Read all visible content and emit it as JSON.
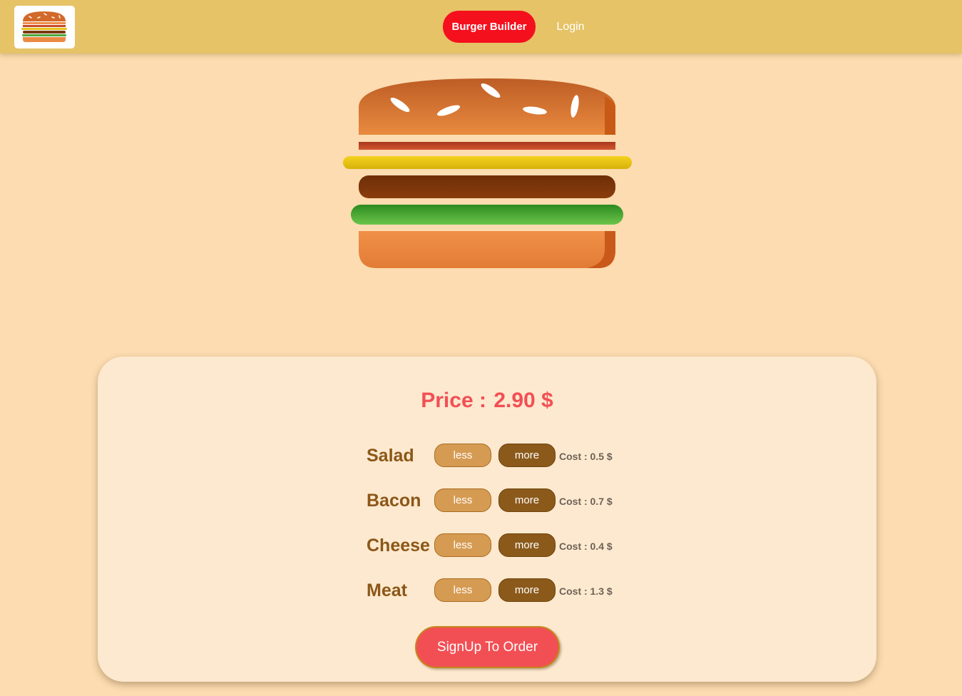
{
  "header": {
    "logo_icon": "burger-logo-icon",
    "nav": {
      "builder_label": "Burger Builder",
      "login_label": "Login"
    },
    "colors": {
      "bar": "#e5c366",
      "active_nav": "#f5101e"
    }
  },
  "burger": {
    "layers": [
      "bread-top",
      "bacon",
      "cheese",
      "meat",
      "salad",
      "bread-bottom"
    ]
  },
  "controls": {
    "price_label": "Price :",
    "price_value": "2.90 $",
    "ingredients": [
      {
        "label": "Salad",
        "less_label": "less",
        "more_label": "more",
        "cost": "Cost : 0.5 $"
      },
      {
        "label": "Bacon",
        "less_label": "less",
        "more_label": "more",
        "cost": "Cost : 0.7 $"
      },
      {
        "label": "Cheese",
        "less_label": "less",
        "more_label": "more",
        "cost": "Cost : 0.4 $"
      },
      {
        "label": "Meat",
        "less_label": "less",
        "more_label": "more",
        "cost": "Cost : 1.3 $"
      }
    ],
    "order_label": "SignUp To Order",
    "colors": {
      "price": "#f24f55",
      "less": "#d69b52",
      "more": "#8b5a1b",
      "order": "#f24f55"
    }
  }
}
